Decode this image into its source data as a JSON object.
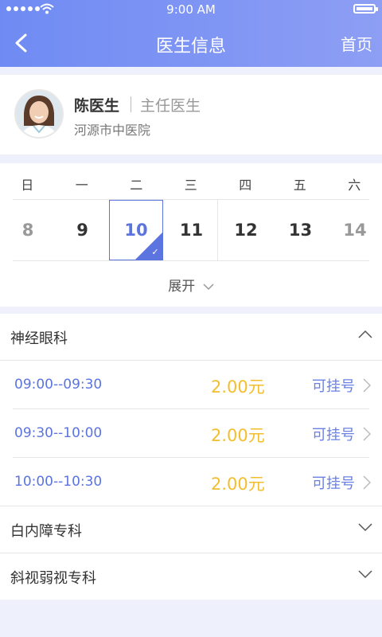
{
  "status_bar": {
    "time": "9:00 AM",
    "signal_icon": "signal-dots-icon",
    "wifi_icon": "wifi-icon",
    "battery_icon": "battery-icon"
  },
  "nav": {
    "title": "医生信息",
    "back_icon": "back-arrow-icon",
    "home_label": "首页"
  },
  "doctor": {
    "name": "陈医生",
    "title": "主任医生",
    "hospital": "河源市中医院"
  },
  "calendar": {
    "weekdays": [
      "日",
      "一",
      "二",
      "三",
      "四",
      "五",
      "六"
    ],
    "dates": [
      "8",
      "9",
      "10",
      "11",
      "12",
      "13",
      "14"
    ],
    "selected_date": "10",
    "expand_label": "展开"
  },
  "departments": [
    {
      "name": "神经眼科",
      "expanded": true,
      "slots": [
        {
          "time": "09:00--09:30",
          "price": "2.00元",
          "status": "可挂号"
        },
        {
          "time": "09:30--10:00",
          "price": "2.00元",
          "status": "可挂号"
        },
        {
          "time": "10:00--10:30",
          "price": "2.00元",
          "status": "可挂号"
        }
      ]
    },
    {
      "name": "白内障专科",
      "expanded": false
    },
    {
      "name": "斜视弱视专科",
      "expanded": false
    }
  ],
  "colors": {
    "header_start": "#6f8bf3",
    "header_end": "#8d9ef4",
    "accent": "#5b74df",
    "price": "#f3be2e",
    "background": "#eef1fb"
  }
}
